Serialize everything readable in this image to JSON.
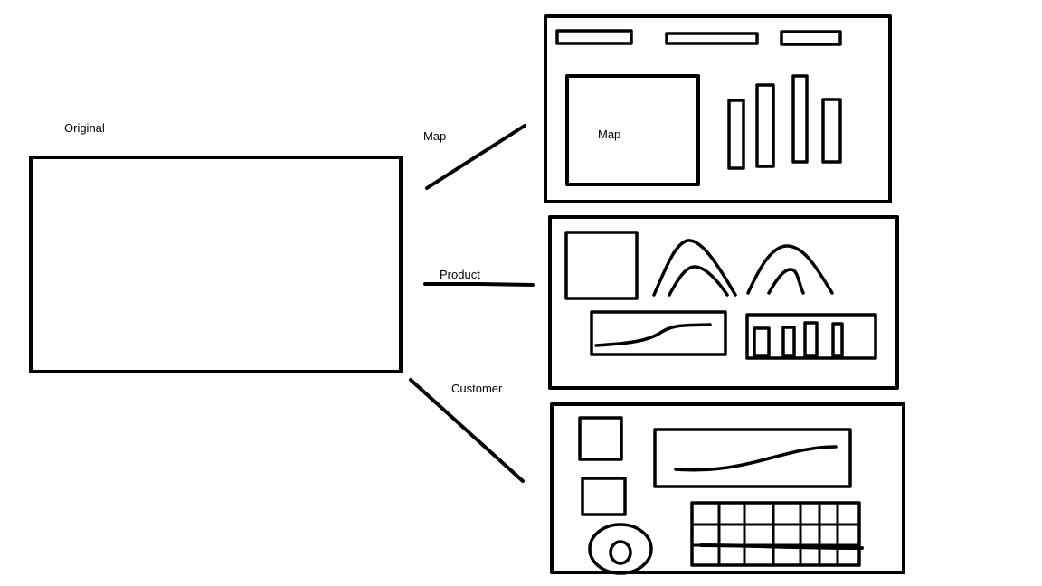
{
  "labels": {
    "original": "Original",
    "map_branch": "Map",
    "product_branch": "Product",
    "customer_branch": "Customer",
    "map_box": "Map"
  },
  "colors": {
    "stroke": "#000000",
    "background": "#ffffff"
  }
}
